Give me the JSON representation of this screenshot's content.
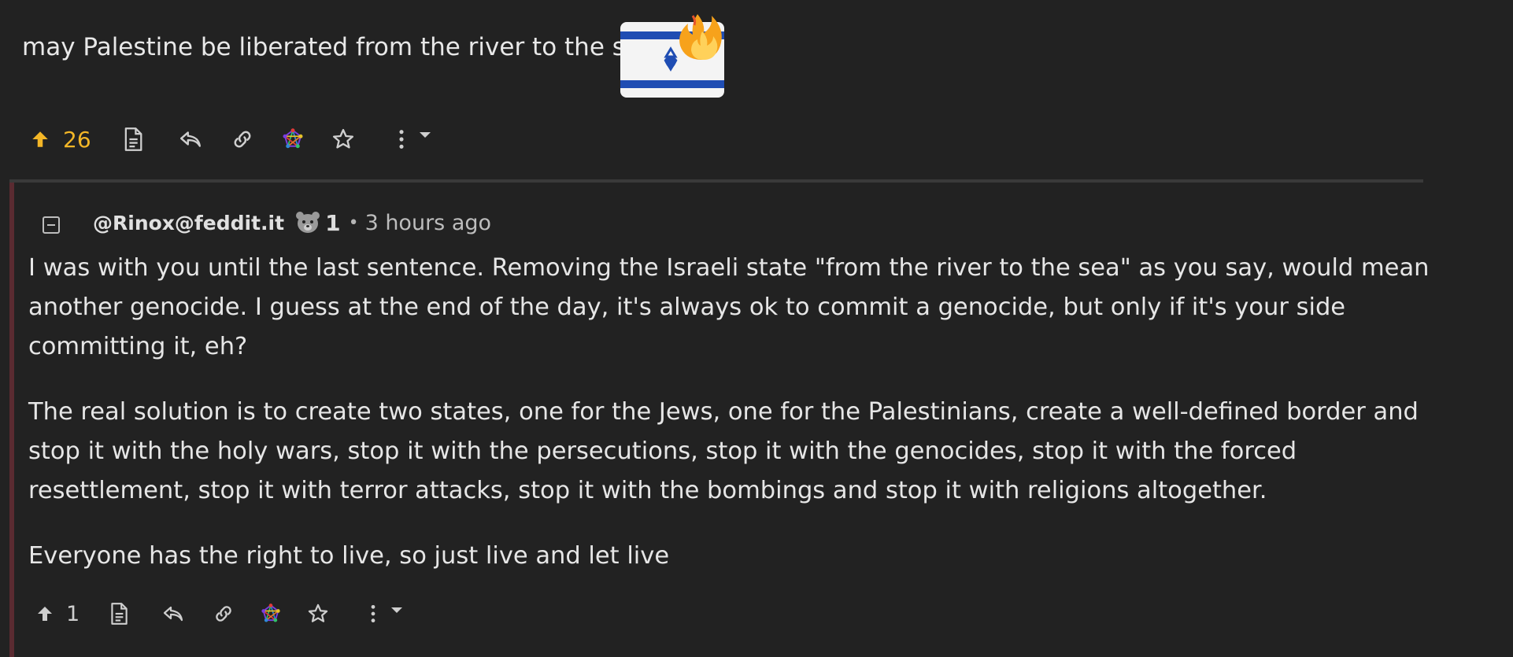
{
  "parent_post": {
    "text": "may Palestine be liberated from the river to the sea",
    "emoji_icon": "israeli-flag-on-fire-emoji",
    "actions": {
      "upvote_count": "26",
      "upvote_color": "#f3b627"
    }
  },
  "comment": {
    "author": "@Rinox@feddit.it",
    "author_icon": "bear-icon",
    "score": "1",
    "separator": "•",
    "time": "3 hours ago",
    "paragraphs": [
      "I was with you until the last sentence. Removing the Israeli state \"from the river to the sea\" as you say, would mean another genocide. I guess at the end of the day, it's always ok to commit a genocide, but only if it's your side committing it, eh?",
      "The real solution is to create two states, one for the Jews, one for the Palestinians, create a well-defined border and stop it with the holy wars, stop it with the persecutions, stop it with the genocides, stop it with the forced resettlement, stop it with terror attacks, stop it with the bombings and stop it with religions altogether.",
      "Everyone has the right to live, so just live and let live"
    ],
    "actions": {
      "upvote_count": "1"
    },
    "border_color": "#5a2b31"
  }
}
